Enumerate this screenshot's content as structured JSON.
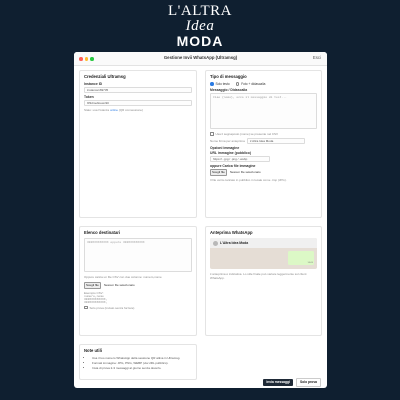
{
  "brand": {
    "line1_a": "L'ALTRA",
    "line1_b": "Idea",
    "line2": "MODA"
  },
  "window": {
    "title": "Gestione Invii WhatsApp (Ultramsg)",
    "exit": "Esci"
  },
  "credentials": {
    "heading": "Credenziali Ultramsg",
    "instance_label": "Instance ID",
    "instance_value": "instance169735",
    "token_label": "Token",
    "token_value": "9f3dme9ouwx9tl",
    "hint_prefix": "Stato: usa l'istanza",
    "hint_link": "online",
    "hint_suffix": "(QR connessione)"
  },
  "message": {
    "heading": "Tipo di messaggio",
    "radio_text": "Solo testo",
    "radio_photo": "Foto + didascalia",
    "msg_label": "Messaggio / Didascalia",
    "msg_placeholder": "Ciao {nome}, ecco il messaggio di test...",
    "csv_check": "Usa il segnaposto {nome} se presente nel CSV",
    "sender_label": "Nome firma per anteprima",
    "sender_value": "L'Altra Idea Moda",
    "image_options": "Opzioni immagine",
    "url_label": "URL immagine (pubblico)",
    "url_placeholder": "https://...jpg / .png / .webp",
    "upload_label": "oppure Carica file immagine",
    "file_btn": "Scegli file",
    "file_txt": "Nessun file selezionato",
    "upload_hint": "Il file verrà caricato in pubblico in locale come .tmp (JPG)."
  },
  "recipients": {
    "heading": "Elenco destinatari",
    "placeholder": "393XXXXXXXXX oppure 393XXXXXXXXX",
    "csv_hint": "Oppure carica un file CSV con due colonne: numero,nome",
    "file_btn": "Scegli file",
    "file_txt": "Nessun file selezionato",
    "example_label": "Esempio CSV:",
    "example_lines": [
      "numero,nome",
      "393XXXXXXXXX,",
      "393XXXXXXXXX,"
    ],
    "check": "Solo prova (inviato senza forzare)"
  },
  "preview": {
    "heading": "Anteprima WhatsApp",
    "name": "L'Altra Idea Moda",
    "time": "14:05",
    "hint": "L'anteprima è indicativa. Lo stile finale può variare leggermente sul client WhatsApp."
  },
  "notes": {
    "heading": "Note utili",
    "items": [
      "Usa il tuo numero WhatsApp della sessione QR attiva in Ultramsg.",
      "Formati immagine: JPG, PNG, WEBP (via URL pubblico).",
      "Invia di prova 2-3 messaggi al giorno senza doverlo."
    ]
  },
  "footer": {
    "send": "Invia messaggi",
    "test": "Solo prova"
  }
}
